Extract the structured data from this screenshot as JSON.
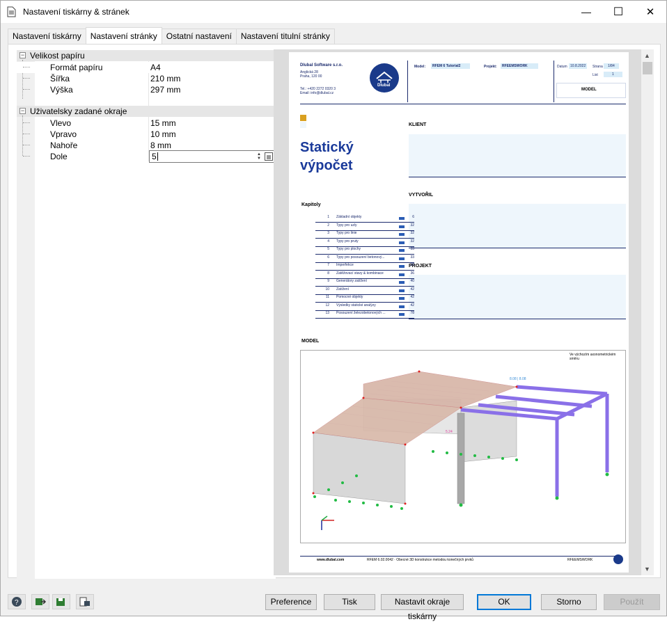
{
  "window": {
    "title": "Nastavení tiskárny & stránek",
    "minimize": "—",
    "maximize": "☐",
    "close": "✕"
  },
  "tabs": [
    {
      "label": "Nastavení tiskárny"
    },
    {
      "label": "Nastavení stránky"
    },
    {
      "label": "Ostatní nastavení"
    },
    {
      "label": "Nastavení titulní stránky"
    }
  ],
  "tree": {
    "paper": {
      "label": "Velikost papíru",
      "toggle": "−",
      "rows": [
        {
          "key": "Formát papíru",
          "value": "A4"
        },
        {
          "key": "Šířka",
          "value": "210 mm"
        },
        {
          "key": "Výška",
          "value": "297 mm"
        }
      ]
    },
    "margins": {
      "label": "Uživatelsky zadané okraje",
      "toggle": "−",
      "rows": [
        {
          "key": "Vlevo",
          "value": "15 mm"
        },
        {
          "key": "Vpravo",
          "value": "10 mm"
        },
        {
          "key": "Nahoře",
          "value": "8 mm"
        },
        {
          "key": "Dole",
          "value": "5"
        }
      ]
    }
  },
  "preview": {
    "company": "Dlubal Software s.r.o.",
    "address1": "Anglická 28",
    "address2": "Praha, 120 00",
    "phone": "Tel.: +420 2272 0320 3",
    "email": "Email: info@dlubal.cz",
    "logo": "Dlubal",
    "model_label": "Model:",
    "model_value": "RFEM 6 Tutorial2",
    "project_label": "Projekt:",
    "project_value": "RFEEMSWORK",
    "date_label": "Datum",
    "date_value": "10.8.2022",
    "page_label": "Strana",
    "page_value": "1/84",
    "sheet_label": "List",
    "sheet_value": "1",
    "header_box": "MODEL",
    "title1": "Statický",
    "title2": "výpočet",
    "client_label": "KLIENT",
    "author_label": "VYTVOŘIL",
    "project_section": "PROJEKT",
    "chapters_label": "Kapitoly",
    "chapters": [
      {
        "n": "1",
        "t": "Základní objekty",
        "p": "6"
      },
      {
        "n": "2",
        "t": "Typy pro uzly",
        "p": "32"
      },
      {
        "n": "3",
        "t": "Typy pro linie",
        "p": "32"
      },
      {
        "n": "4",
        "t": "Typy pro pruty",
        "p": "32"
      },
      {
        "n": "5",
        "t": "Typy pro plochy",
        "p": "33"
      },
      {
        "n": "6",
        "t": "Typy pro posouzení betonový...",
        "p": "33"
      },
      {
        "n": "7",
        "t": "Imperfekce",
        "p": "35"
      },
      {
        "n": "8",
        "t": "Zatěžovací stavy & kombinace",
        "p": "36"
      },
      {
        "n": "9",
        "t": "Generátory zatížení",
        "p": "40"
      },
      {
        "n": "10",
        "t": "Zatížení",
        "p": "42"
      },
      {
        "n": "11",
        "t": "Pomocné objekty",
        "p": "42"
      },
      {
        "n": "12",
        "t": "Výsledky statické analýzy",
        "p": "42"
      },
      {
        "n": "13",
        "t": "Posouzení železobetonových ...",
        "p": "78"
      }
    ],
    "model_section": "MODEL",
    "model_view": "Ve výchozím axonometrickém směru",
    "dim1": "8.08 | 8.08",
    "dim2": "5.24",
    "footer_web": "www.dlubal.com",
    "footer_sw": "RFEM 6.02.0042 · Obecné 3D konstrukce metodou konečných prvků",
    "footer_project": "RFEEMSWORK"
  },
  "buttons": {
    "preference": "Preference",
    "print": "Tisk",
    "set_margins": "Nastavit okraje tiskárny",
    "ok": "OK",
    "cancel": "Storno",
    "apply": "Použít"
  },
  "icons": {
    "help": "help-icon",
    "export": "export-icon",
    "save": "save-settings-icon",
    "load": "load-settings-icon"
  }
}
